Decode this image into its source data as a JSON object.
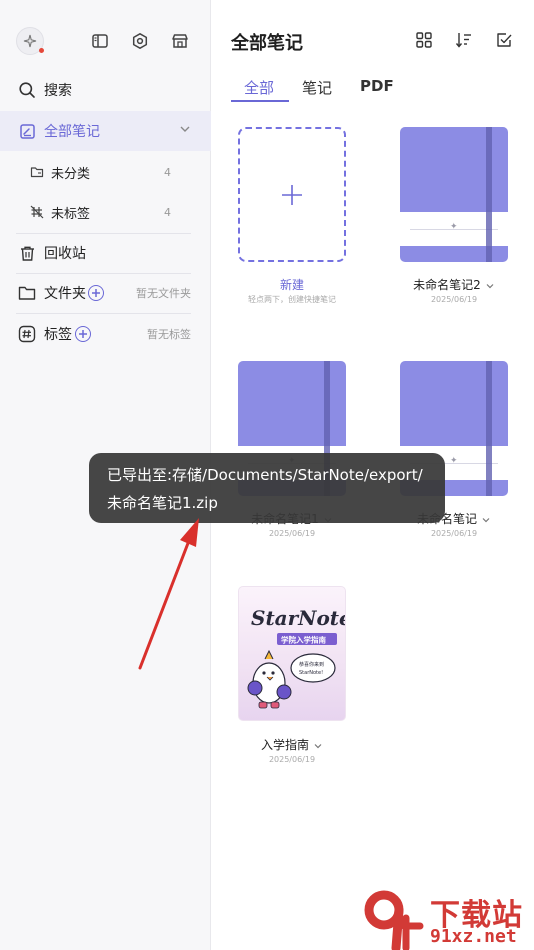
{
  "sidebar": {
    "search_label": "搜索",
    "all_notes_label": "全部笔记",
    "uncategorized_label": "未分类",
    "uncategorized_count": "4",
    "untagged_label": "未标签",
    "untagged_count": "4",
    "trash_label": "回收站",
    "folders_label": "文件夹",
    "folders_hint": "暂无文件夹",
    "tags_label": "标签",
    "tags_hint": "暂无标签"
  },
  "header": {
    "title": "全部笔记",
    "tabs": [
      {
        "label": "全部",
        "active": true
      },
      {
        "label": "笔记",
        "active": false
      },
      {
        "label": "PDF",
        "active": false
      }
    ]
  },
  "notes": {
    "new_label": "新建",
    "new_hint": "轻点两下，创建快捷笔记",
    "items": [
      {
        "name": "未命名笔记2",
        "date": "2025/06/19"
      },
      {
        "name": "未命名笔记1",
        "date": "2025/06/19"
      },
      {
        "name": "未命名笔记",
        "date": "2025/06/19"
      },
      {
        "name": "入学指南",
        "date": "2025/06/19"
      }
    ]
  },
  "cover": {
    "brand": "StarNote",
    "subtitle": "学院入学指南",
    "bubble_line1": "恭喜你来到",
    "bubble_line2": "StarNote!"
  },
  "toast": {
    "line1": "已导出至:存储/Documents/StarNote/export/",
    "line2": "未命名笔记1.zip"
  },
  "watermark": {
    "logo": "9f",
    "text": "下载站",
    "url": "91xz.net"
  },
  "colors": {
    "accent": "#6a68d6",
    "notebook": "#8c8ce4",
    "toast_bg": "#383838",
    "arrow": "#d9302c"
  }
}
